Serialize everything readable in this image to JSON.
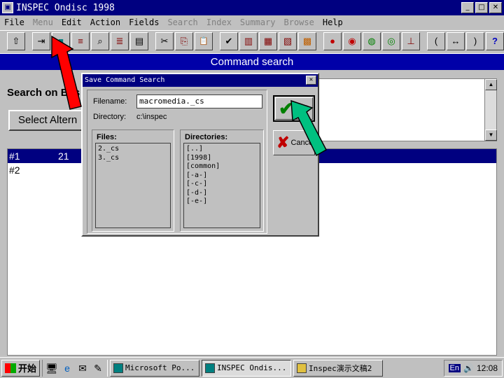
{
  "window": {
    "title": "INSPEC Ondisc 1998",
    "controls": [
      "_",
      "□",
      "✕"
    ]
  },
  "menu": [
    {
      "label": "File",
      "enabled": true
    },
    {
      "label": "Menu",
      "enabled": false
    },
    {
      "label": "Edit",
      "enabled": true
    },
    {
      "label": "Action",
      "enabled": true
    },
    {
      "label": "Fields",
      "enabled": true
    },
    {
      "label": "Search",
      "enabled": false
    },
    {
      "label": "Index",
      "enabled": false
    },
    {
      "label": "Summary",
      "enabled": false
    },
    {
      "label": "Browse",
      "enabled": false
    },
    {
      "label": "Help",
      "enabled": true
    }
  ],
  "toolbar": {
    "buttons": [
      {
        "name": "export-icon",
        "glyph": "⇧"
      },
      {
        "name": "save-search-icon",
        "glyph": "⇥"
      },
      {
        "name": "save-icon",
        "glyph": "■"
      },
      {
        "name": "print-list-icon",
        "glyph": "≡"
      },
      {
        "name": "magnify-icon",
        "glyph": "⌕"
      },
      {
        "name": "list-icon",
        "glyph": "≣"
      },
      {
        "name": "document-icon",
        "glyph": "▤"
      },
      {
        "name": "cut-icon",
        "glyph": "✂"
      },
      {
        "name": "copy-icon",
        "glyph": "⎘"
      },
      {
        "name": "paste-icon",
        "glyph": "📋"
      },
      {
        "name": "mark-icon",
        "glyph": "✔"
      },
      {
        "name": "record-icon",
        "glyph": "▥"
      },
      {
        "name": "records-icon",
        "glyph": "▦"
      },
      {
        "name": "full-record-icon",
        "glyph": "▧"
      },
      {
        "name": "abacus-icon",
        "glyph": "▩"
      },
      {
        "name": "and-icon",
        "glyph": "●"
      },
      {
        "name": "or-icon",
        "glyph": "◉"
      },
      {
        "name": "not-icon",
        "glyph": "◍"
      },
      {
        "name": "near-icon",
        "glyph": "◎"
      },
      {
        "name": "tree-icon",
        "glyph": "⊥"
      },
      {
        "name": "open-paren-icon",
        "glyph": "("
      },
      {
        "name": "range-icon",
        "glyph": "↔"
      },
      {
        "name": "close-paren-icon",
        "glyph": ")"
      },
      {
        "name": "help-icon",
        "glyph": "?"
      }
    ]
  },
  "command_header": "Command search",
  "background": {
    "search_label": "Search on Bas",
    "select_button": "Select Altern"
  },
  "results": [
    {
      "id": "#1",
      "count": "21",
      "selected": true
    },
    {
      "id": "#2",
      "count": "",
      "selected": false
    }
  ],
  "dialog": {
    "title": "Save Command Search",
    "filename_label": "Filename:",
    "filename_value": "macromedia._cs",
    "directory_label": "Directory:",
    "directory_value": "c:\\inspec",
    "files_label": "Files:",
    "files": [
      "2._cs",
      "3._cs"
    ],
    "directories_label": "Directories:",
    "directories": [
      "[..]",
      "[1998]",
      "[common]",
      "[-a-]",
      "[-c-]",
      "[-d-]",
      "[-e-]"
    ],
    "ok_label": "OK",
    "cancel_label": "Cancel"
  },
  "taskbar": {
    "start_label": "开始",
    "tasks": [
      {
        "label": "Microsoft Po...",
        "active": false
      },
      {
        "label": "INSPEC Ondis...",
        "active": true
      },
      {
        "label": "Inspec演示文稿2",
        "active": false
      }
    ],
    "lang": "En",
    "clock": "12:08"
  },
  "colors": {
    "titlebar": "#000080",
    "header": "#0000a8",
    "red_arrow": "#ff0000",
    "green_arrow": "#00c080"
  }
}
